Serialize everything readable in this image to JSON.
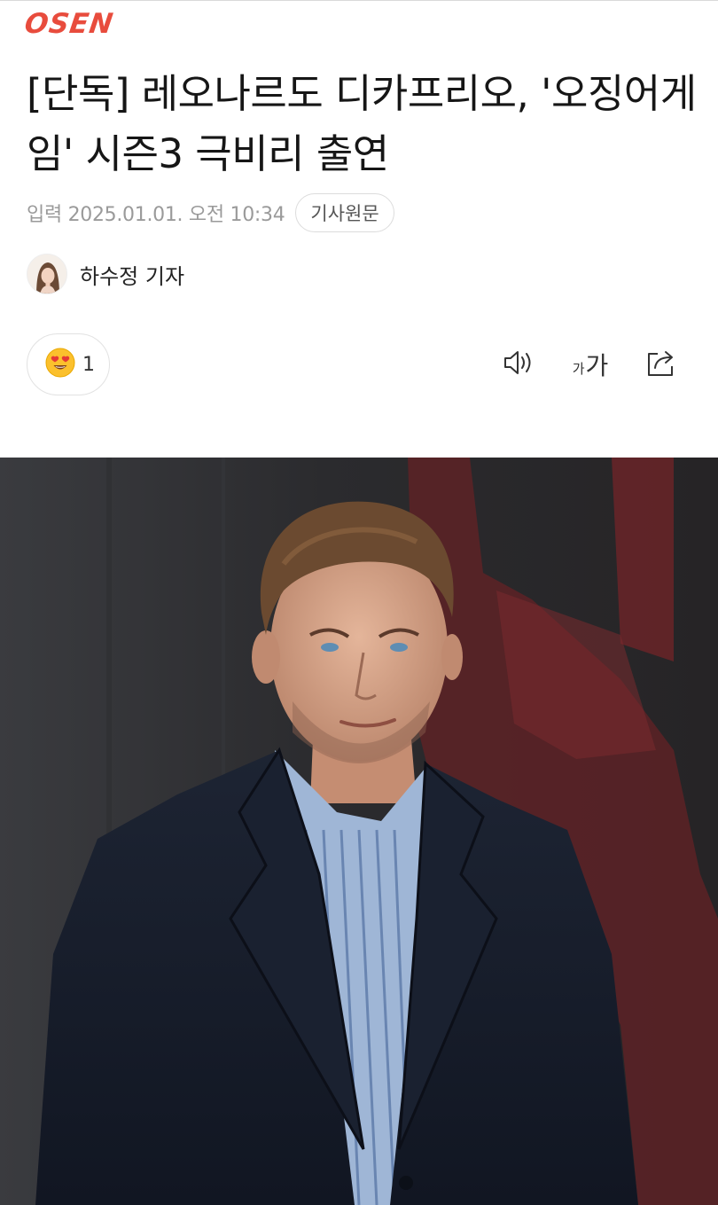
{
  "header": {
    "logo_text": "OSEN",
    "logo_color": "#e84c3d"
  },
  "article": {
    "headline": "[단독] 레오나르도 디카프리오, '오징어게임' 시즌3 극비리 출연",
    "published": "입력 2025.01.01. 오전 10:34",
    "source_button": "기사원문",
    "author": "하수정 기자"
  },
  "reactions": {
    "emoji_icon": "heart-eyes-emoji-icon",
    "count": "1"
  },
  "toolbar": {
    "speaker_icon": "speaker-icon",
    "font_size_small": "가",
    "font_size_large": "가",
    "share_icon": "share-icon"
  },
  "photo": {
    "description_icon": "article-photo"
  }
}
